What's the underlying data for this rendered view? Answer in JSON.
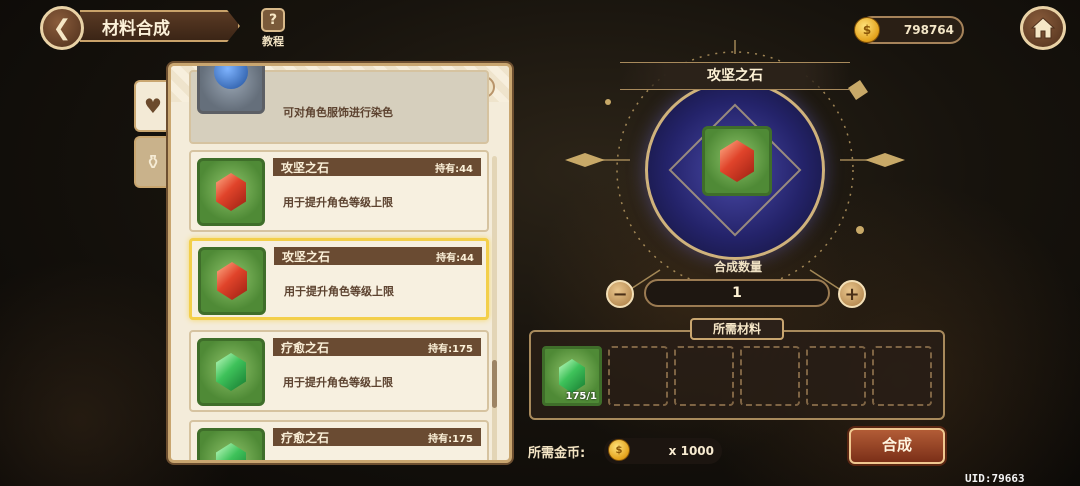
{
  "header": {
    "title": "材料合成",
    "tutorial_label": "教程",
    "tutorial_icon": "?",
    "gold_amount": "798764"
  },
  "side_tabs": [
    {
      "icon": "heart-diamond-icon",
      "glyph": "♥"
    },
    {
      "icon": "potion-bag-icon",
      "glyph": "⚱"
    }
  ],
  "list": {
    "items": [
      {
        "name": "",
        "count": "",
        "desc": "可对角色服饰进行染色",
        "gem": "blue"
      },
      {
        "name": "攻坚之石",
        "count": "持有:44",
        "desc": "用于提升角色等级上限",
        "gem": "red"
      },
      {
        "name": "攻坚之石",
        "count": "持有:44",
        "desc": "用于提升角色等级上限",
        "gem": "red"
      },
      {
        "name": "疗愈之石",
        "count": "持有:175",
        "desc": "用于提升角色等级上限",
        "gem": "green"
      },
      {
        "name": "疗愈之石",
        "count": "持有:175",
        "desc": "",
        "gem": "green"
      }
    ]
  },
  "result": {
    "name": "攻坚之石",
    "quantity_label": "合成数量",
    "quantity": "1",
    "minus": "−",
    "plus": "+"
  },
  "materials": {
    "title": "所需材料",
    "slots": [
      {
        "filled": true,
        "count": "175/1",
        "gem": "green"
      },
      {
        "filled": false
      },
      {
        "filled": false
      },
      {
        "filled": false
      },
      {
        "filled": false
      },
      {
        "filled": false
      }
    ]
  },
  "cost": {
    "label": "所需金币:",
    "amount": "x 1000"
  },
  "synth_button": "合成",
  "uid": "UID:79663",
  "colors": {
    "accent_gold": "#c9a670",
    "panel_bg": "#f4ecda",
    "selected_border": "#f3cf4a",
    "synth_button": "#a44d2b"
  }
}
